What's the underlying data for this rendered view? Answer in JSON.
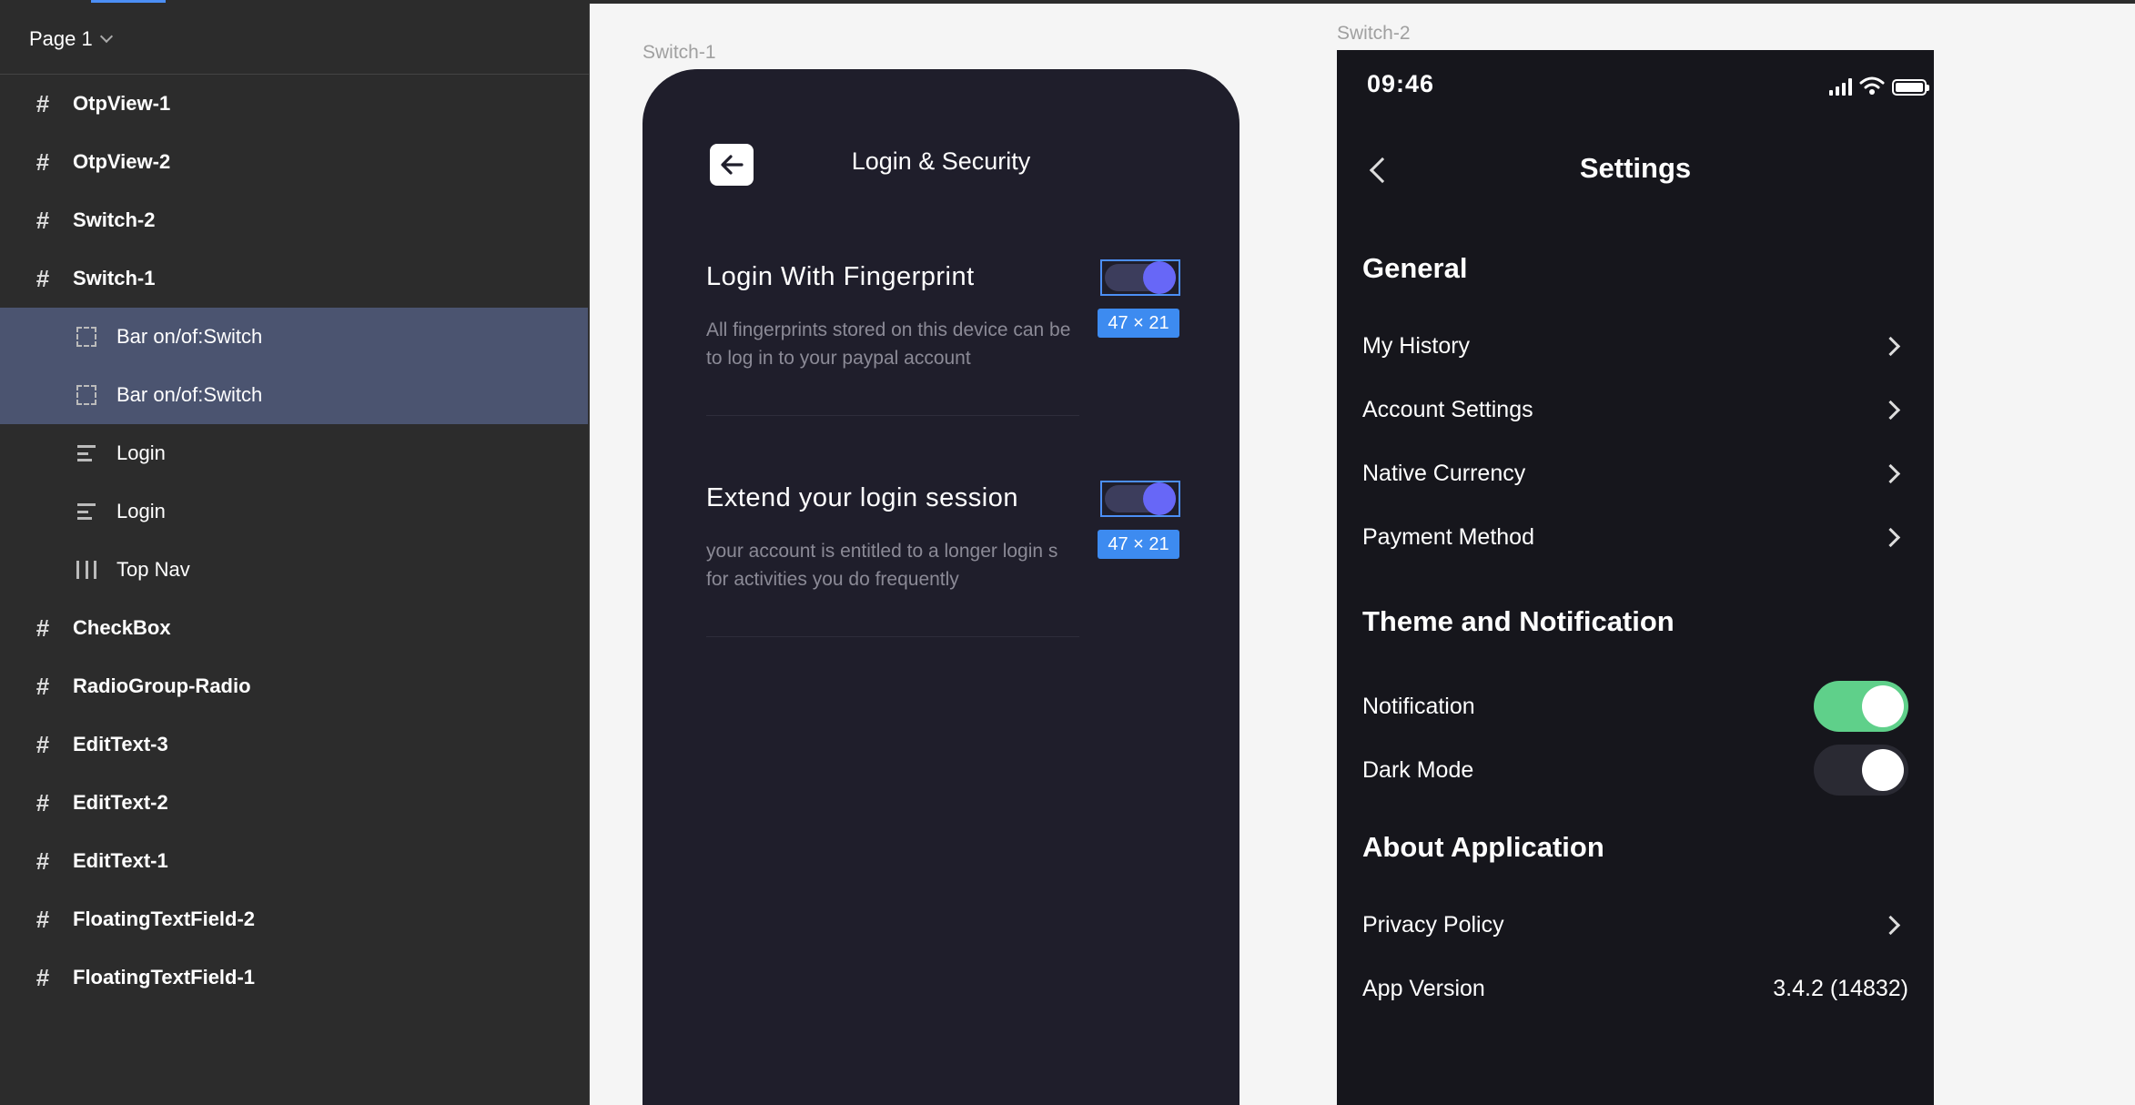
{
  "layers_panel": {
    "page_label": "Page 1",
    "items": [
      {
        "label": "OtpView-1",
        "kind": "frame"
      },
      {
        "label": "OtpView-2",
        "kind": "frame"
      },
      {
        "label": "Switch-2",
        "kind": "frame"
      },
      {
        "label": "Switch-1",
        "kind": "frame"
      },
      {
        "label": "Bar on/of:Switch",
        "kind": "component",
        "selected": true
      },
      {
        "label": "Bar on/of:Switch",
        "kind": "component",
        "selected": true
      },
      {
        "label": "Login",
        "kind": "text"
      },
      {
        "label": "Login",
        "kind": "text"
      },
      {
        "label": "Top Nav",
        "kind": "autolayout"
      },
      {
        "label": "CheckBox",
        "kind": "frame"
      },
      {
        "label": "RadioGroup-Radio",
        "kind": "frame"
      },
      {
        "label": "EditText-3",
        "kind": "frame"
      },
      {
        "label": "EditText-2",
        "kind": "frame"
      },
      {
        "label": "EditText-1",
        "kind": "frame"
      },
      {
        "label": "FloatingTextField-2",
        "kind": "frame"
      },
      {
        "label": "FloatingTextField-1",
        "kind": "frame"
      }
    ]
  },
  "switch1": {
    "frame_label": "Switch-1",
    "nav_title": "Login & Security",
    "rows": [
      {
        "title": "Login With Fingerprint",
        "desc1": "All fingerprints stored on this device can be",
        "desc2": "to log in to your paypal account",
        "badge": "47 × 21",
        "on": true
      },
      {
        "title": "Extend your login session",
        "desc1": "your account is entitled to a longer login s",
        "desc2": "for activities you do frequently",
        "badge": "47 × 21",
        "on": true
      }
    ]
  },
  "switch2": {
    "frame_label": "Switch-2",
    "time": "09:46",
    "title": "Settings",
    "sections": {
      "general": "General",
      "theme": "Theme and Notification",
      "about": "About Application"
    },
    "general_items": [
      "My History",
      "Account Settings",
      "Native Currency",
      "Payment Method"
    ],
    "notification_label": "Notification",
    "notification_on": true,
    "dark_mode_label": "Dark Mode",
    "dark_mode_on": true,
    "privacy_label": "Privacy Policy",
    "app_version_label": "App Version",
    "app_version_value": "3.4.2 (14832)"
  },
  "colors": {
    "panel_bg": "#2c2c2c",
    "selection": "#4b5470",
    "accent_blue": "#4c8ff5",
    "switch_knob": "#6767f7",
    "toggle_green": "#5fd08a",
    "frame_dark": "#1f1e2b"
  }
}
